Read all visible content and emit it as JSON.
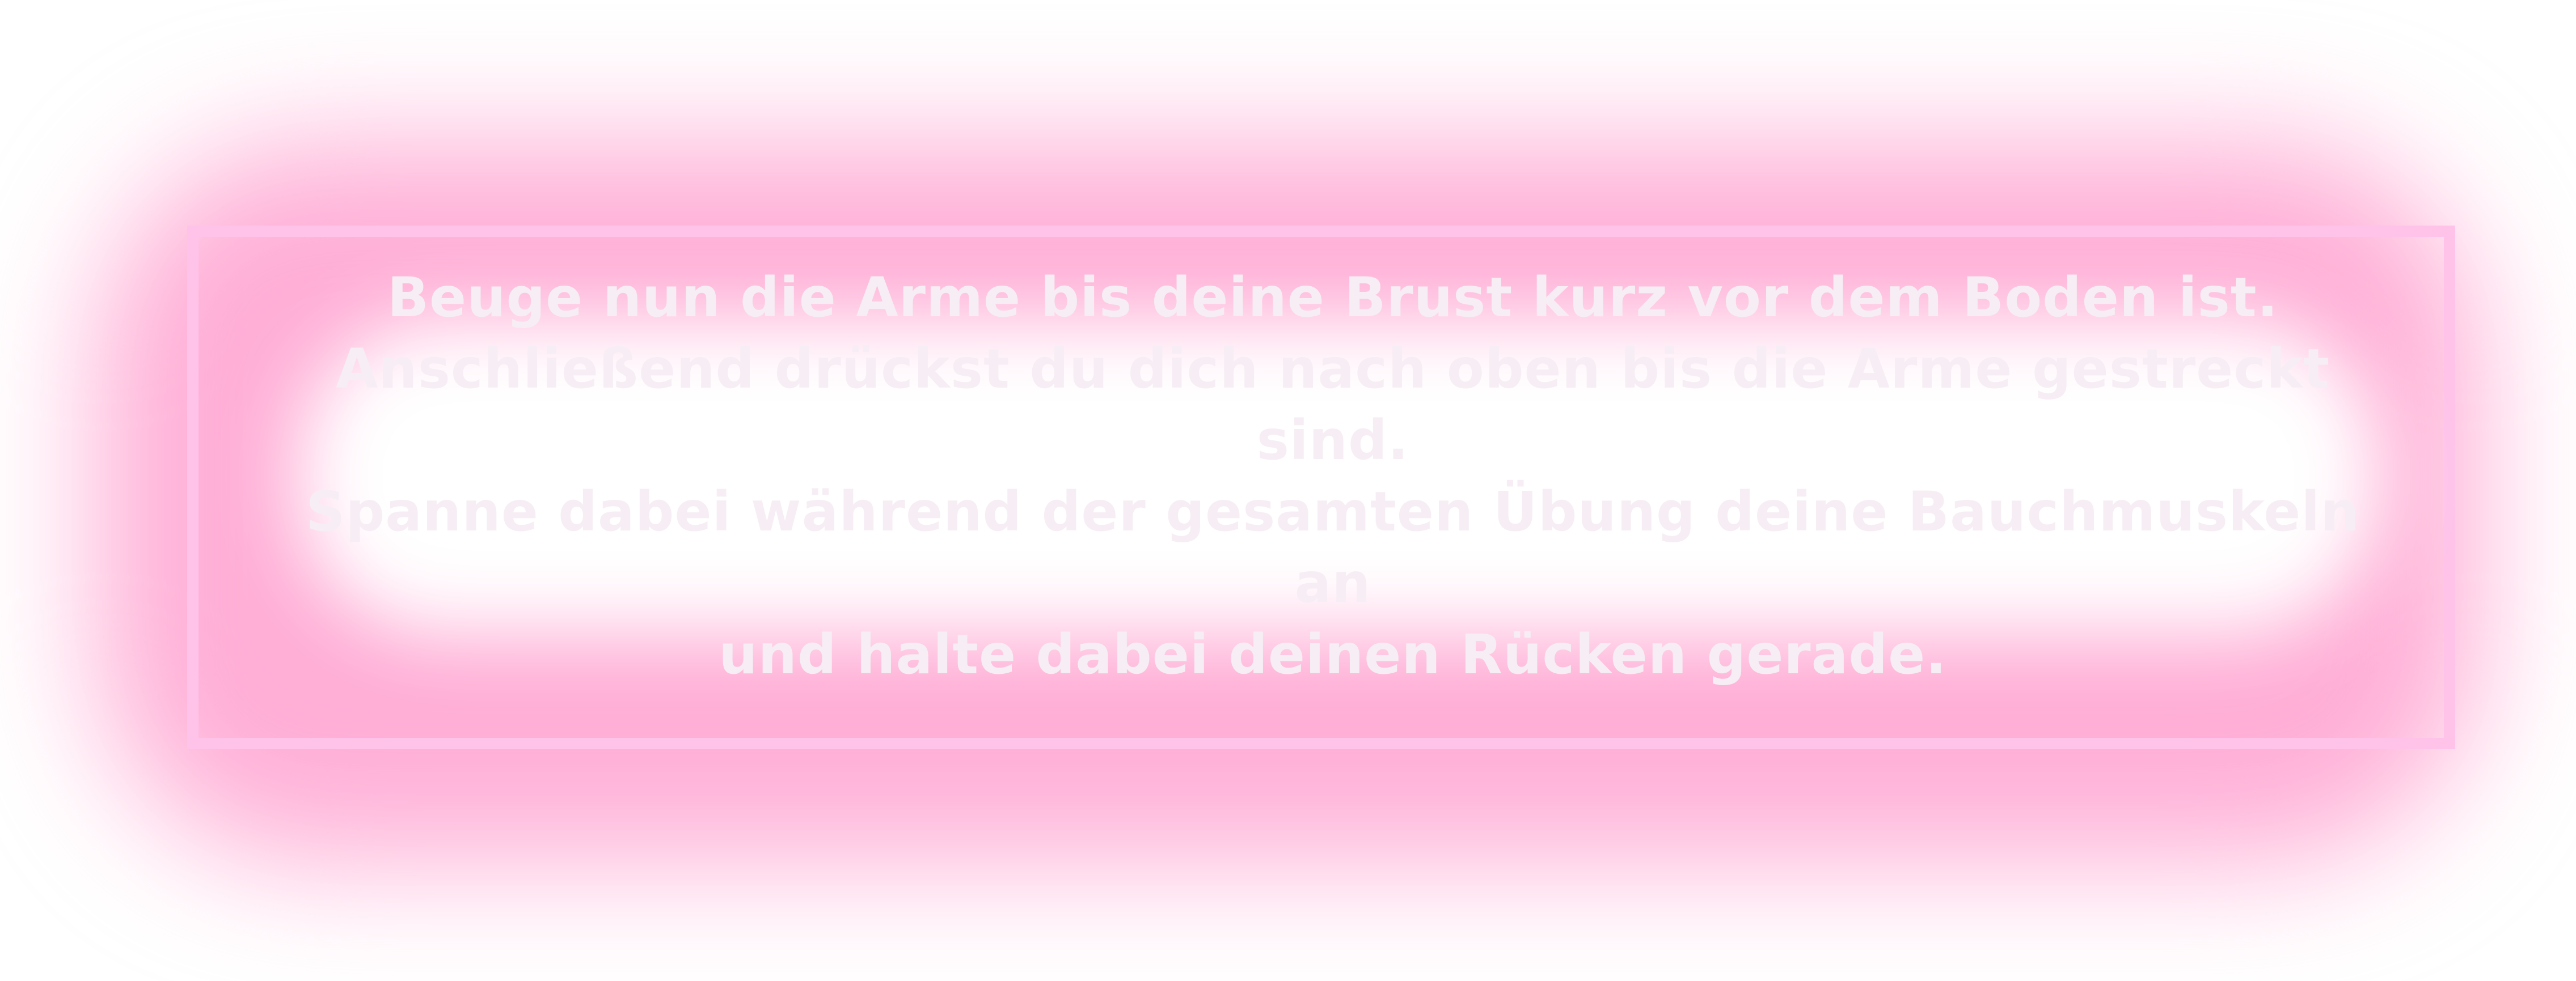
{
  "instruction": {
    "lines": [
      "Beuge nun die Arme bis deine Brust kurz vor dem Boden ist.",
      "Anschließend drückst du dich nach oben bis die Arme gestreckt sind.",
      "Spanne dabei während der gesamten Übung deine Bauchmuskeln an",
      "und halte dabei deinen Rücken gerade."
    ]
  },
  "colors": {
    "glow": "#ffaed6",
    "frame": "#ffc3ea",
    "text": "#f6eef4",
    "background": "#ffffff"
  }
}
